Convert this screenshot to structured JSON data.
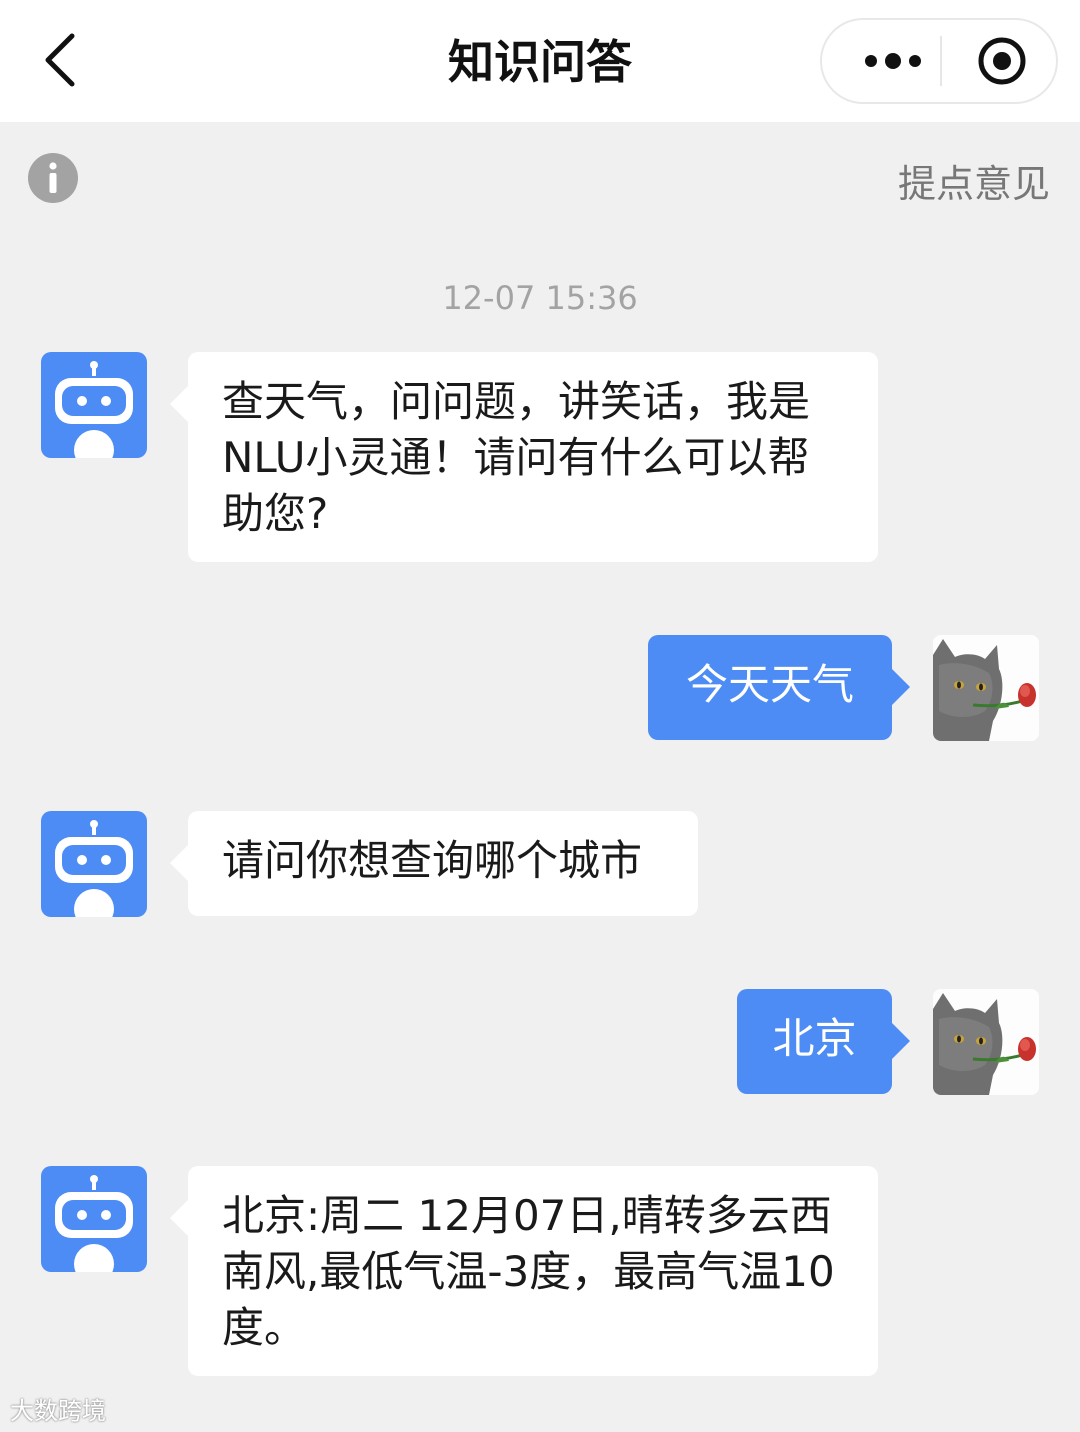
{
  "nav": {
    "title": "知识问答",
    "back_icon": "chevron-left-icon",
    "more_icon": "more-dots-icon",
    "close_icon": "target-close-icon"
  },
  "toolbar": {
    "info_icon": "info-icon",
    "feedback_label": "提点意见"
  },
  "chat": {
    "timestamp": "12-07 15:36",
    "messages": [
      {
        "role": "bot",
        "text": "查天气，问问题，讲笑话，我是NLU小灵通！请问有什么可以帮助您?"
      },
      {
        "role": "user",
        "text": "今天天气"
      },
      {
        "role": "bot",
        "text": "请问你想查询哪个城市"
      },
      {
        "role": "user",
        "text": "北京"
      },
      {
        "role": "bot",
        "text": "北京:周二 12月07日,晴转多云西南风,最低气温-3度，最高气温10度。"
      }
    ]
  },
  "watermark": "大数跨境",
  "colors": {
    "accent": "#4d8cf5",
    "background": "#f0f0f0",
    "bubble_bot": "#ffffff"
  }
}
